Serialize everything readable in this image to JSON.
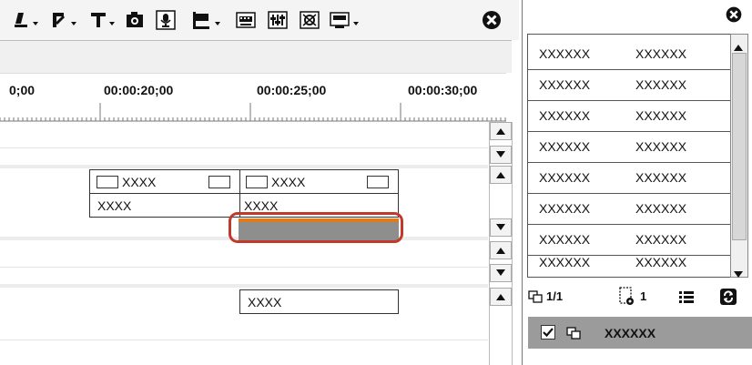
{
  "toolbar": {
    "buttons": [
      {
        "name": "in-point-icon"
      },
      {
        "name": "out-point-icon"
      },
      {
        "name": "title-icon"
      },
      {
        "name": "camera-icon"
      },
      {
        "name": "audio-record-icon"
      },
      {
        "name": "marker-icon"
      },
      {
        "name": "keyboard-icon"
      },
      {
        "name": "mixer-icon"
      },
      {
        "name": "effects-icon"
      },
      {
        "name": "display-icon"
      }
    ],
    "close_label": "✖"
  },
  "timeline": {
    "timecodes": [
      "0;00",
      "00:00:20;00",
      "00:00:25;00",
      "00:00:30;00"
    ],
    "clips": [
      {
        "label": "XXXX"
      },
      {
        "label": "XXXX"
      },
      {
        "label": "XXXX"
      },
      {
        "label": "XXXX"
      },
      {
        "label": "XXXX"
      }
    ],
    "highlight_color": "#c0392b",
    "accent_color": "#e07a1a"
  },
  "right_panel": {
    "rows": [
      [
        "XXXXXX",
        "XXXXXX"
      ],
      [
        "XXXXXX",
        "XXXXXX"
      ],
      [
        "XXXXXX",
        "XXXXXX"
      ],
      [
        "XXXXXX",
        "XXXXXX"
      ],
      [
        "XXXXXX",
        "XXXXXX"
      ],
      [
        "XXXXXX",
        "XXXXXX"
      ],
      [
        "XXXXXX",
        "XXXXXX"
      ],
      [
        "XXXXXX",
        "XXXXXX"
      ]
    ],
    "page": "1/1",
    "count": "1",
    "list_item": {
      "label": "XXXXXX",
      "checked": true
    }
  }
}
